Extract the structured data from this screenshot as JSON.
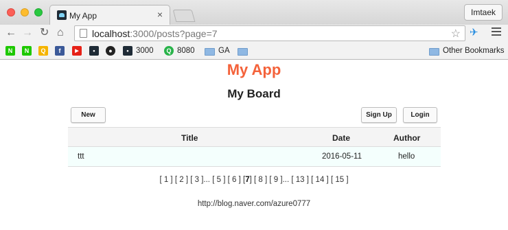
{
  "browser": {
    "tab_title": "My App",
    "tab_close": "×",
    "profile_name": "Imtaek",
    "url_host": "localhost",
    "url_rest": ":3000/posts?page=7",
    "icons": {
      "back": "back-arrow-icon",
      "forward": "forward-arrow-icon",
      "reload": "reload-icon",
      "home": "home-icon",
      "star": "bookmark-star-icon",
      "menu": "hamburger-menu-icon"
    }
  },
  "bookmarks": {
    "items": [
      {
        "label": "",
        "icon": "naver-icon",
        "color": "#1ec800",
        "glyph": "N"
      },
      {
        "label": "",
        "icon": "naver-icon",
        "color": "#1ec800",
        "glyph": "N"
      },
      {
        "label": "",
        "icon": "app-icon",
        "color": "#f5b400",
        "glyph": "Q"
      },
      {
        "label": "",
        "icon": "facebook-icon",
        "color": "#3b5998",
        "glyph": "f"
      },
      {
        "label": "",
        "icon": "youtube-icon",
        "color": "#e62117",
        "glyph": "▶"
      },
      {
        "label": "",
        "icon": "app-icon",
        "color": "#1f2b36",
        "glyph": "•"
      },
      {
        "label": "",
        "icon": "github-icon",
        "color": "#222222",
        "glyph": "●"
      },
      {
        "label": "3000",
        "icon": "app-favicon-icon",
        "color": "#1f2b36",
        "glyph": "•"
      },
      {
        "label": "8080",
        "icon": "refresh-green-icon",
        "color": "#29b34a",
        "glyph": "Q"
      },
      {
        "label": "GA",
        "icon": "folder-icon"
      },
      {
        "label": "",
        "icon": "folder-icon"
      }
    ],
    "other": "Other Bookmarks"
  },
  "page": {
    "app_title": "My App",
    "board_title": "My Board",
    "buttons": {
      "new": "New",
      "signup": "Sign Up",
      "login": "Login"
    },
    "table": {
      "headers": {
        "title": "Title",
        "date": "Date",
        "author": "Author"
      },
      "rows": [
        {
          "title": "ttt",
          "date": "2016-05-11",
          "author": "hello"
        }
      ]
    },
    "pagination": {
      "items": [
        "[ 1 ]",
        "[ 2 ]",
        "[ 3 ]",
        "...",
        "[ 5 ]",
        "[ 6 ]",
        "[",
        "7",
        "]",
        "[ 8 ]",
        "[ 9 ]",
        "...",
        "[ 13 ]",
        "[ 14 ]",
        "[ 15 ]"
      ],
      "current": "7"
    },
    "footer": "http://blog.naver.com/azure0777"
  },
  "colors": {
    "app_title": "#f4623a",
    "row_highlight": "#f4fffd"
  }
}
